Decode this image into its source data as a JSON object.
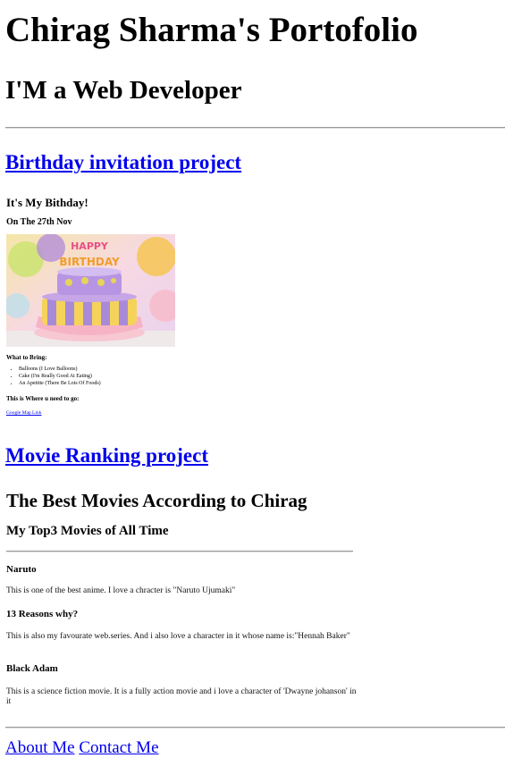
{
  "header": {
    "title": "Chirag Sharma's Portofolio",
    "subtitle": "I'M a Web Developer"
  },
  "projects": {
    "birthday_link": "Birthday invitation project",
    "movie_link": "Movie Ranking project"
  },
  "birthday_preview": {
    "heading": "It's My Bithday!",
    "date": "On The 27th Nov",
    "image": "birthday-cake-image",
    "bring_heading": "What to Bring:",
    "items": [
      "Balloons (I Love Balloons)",
      "Cake (I'm Really Good At Eating)",
      "An Apetitte (There Be Lots Of Foods)"
    ],
    "where_heading": "This is Where u need to go:",
    "map_link": "Google Map Link"
  },
  "movie_preview": {
    "heading": "The Best Movies According to Chirag",
    "subheading": "My Top3 Movies of All Time",
    "movies": [
      {
        "title": "Naruto",
        "desc": "This is one of the best anime. I love a chracter is \"Naruto Ujumaki\""
      },
      {
        "title": "13 Reasons why?",
        "desc": "This is also my favourate web.series. And i also love a character in it whose name is:\"Hennah Baker\""
      },
      {
        "title": "Black Adam",
        "desc": "This is a science fiction movie. It is a fully action movie and i love a character of 'Dwayne johanson' in it"
      }
    ]
  },
  "footer": {
    "about": "About Me",
    "contact": "Contact Me"
  }
}
